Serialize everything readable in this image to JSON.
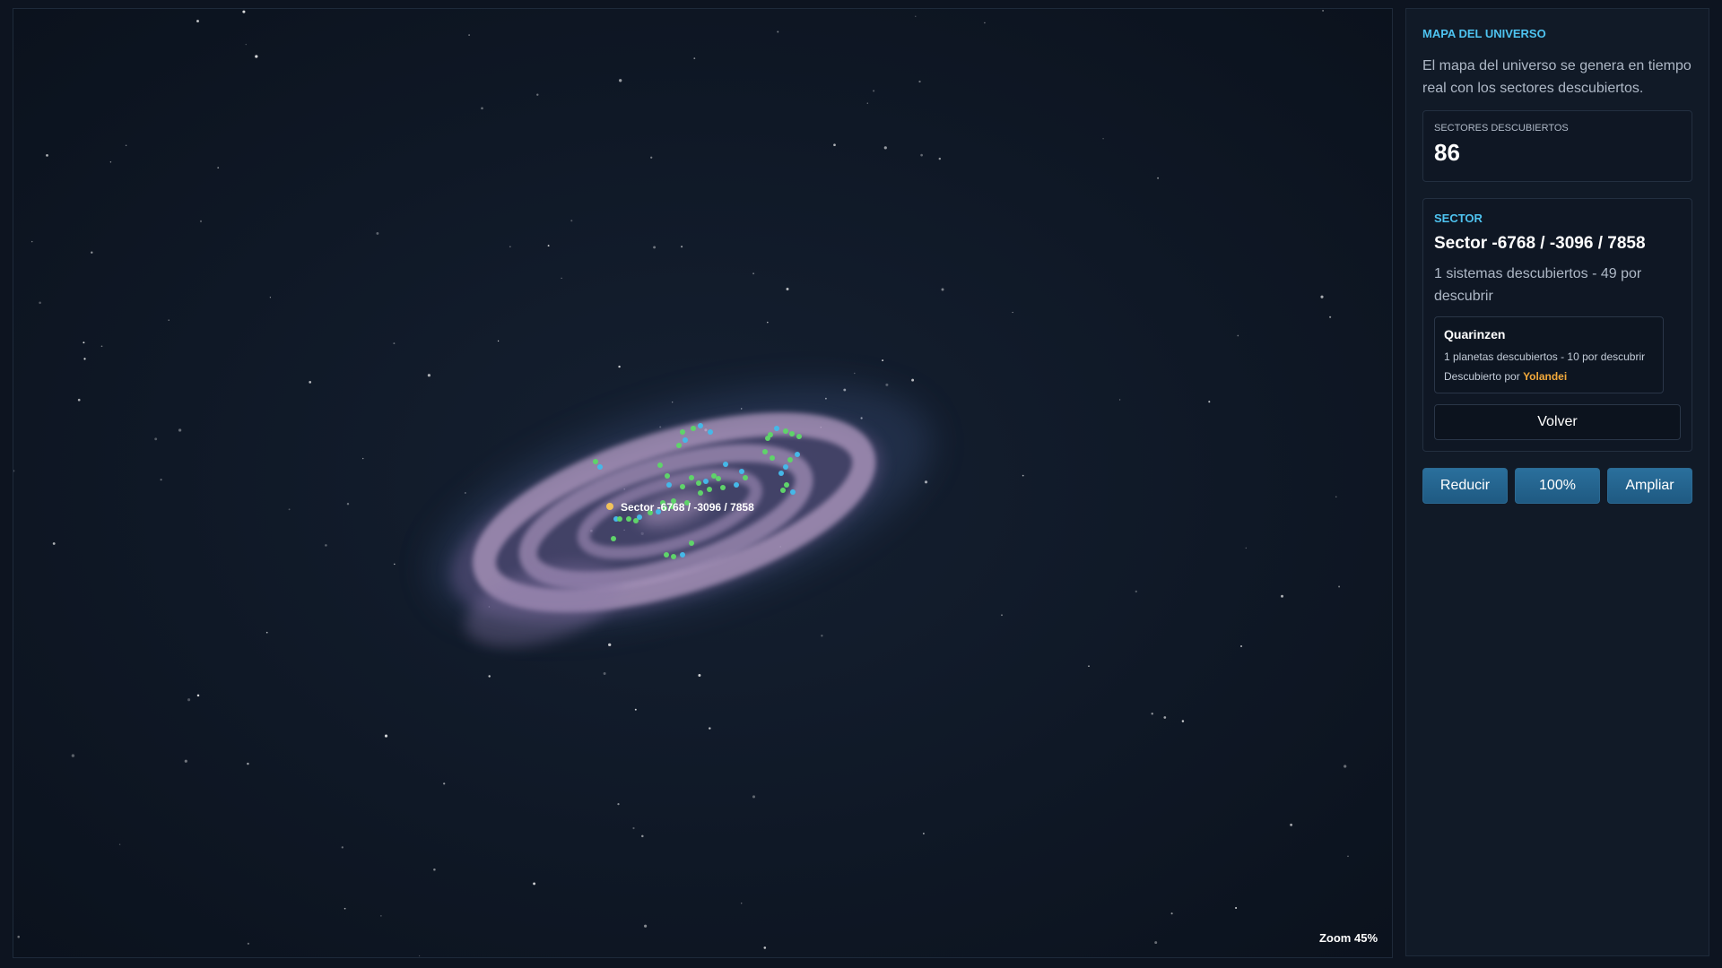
{
  "map": {
    "zoom_label": "Zoom 45%",
    "selected_sector_label": "Sector -6768 / -3096 / 7858",
    "colors": {
      "background": "#0f1826",
      "system_green": "#5fd36a",
      "system_blue": "#45b8e8",
      "selected_marker": "#f2c35b",
      "galaxy_glow": "#c9a6d8"
    }
  },
  "panel": {
    "heading": "MAPA DEL UNIVERSO",
    "description": "El mapa del universo se genera en tiempo real con los sectores descubiertos.",
    "stats": {
      "label": "SECTORES DESCUBIERTOS",
      "value": "86"
    },
    "sector": {
      "tag": "SECTOR",
      "title": "Sector -6768 / -3096 / 7858",
      "info": "1 sistemas descubiertos - 49 por descubrir",
      "system": {
        "name": "Quarinzen",
        "planets": "1 planetas descubiertos - 10 por descubrir",
        "discovered_prefix": "Descubierto por",
        "discoverer": "Yolandei"
      },
      "back_label": "Volver"
    },
    "zoom_buttons": {
      "reduce": "Reducir",
      "reset": "100%",
      "enlarge": "Ampliar"
    }
  }
}
